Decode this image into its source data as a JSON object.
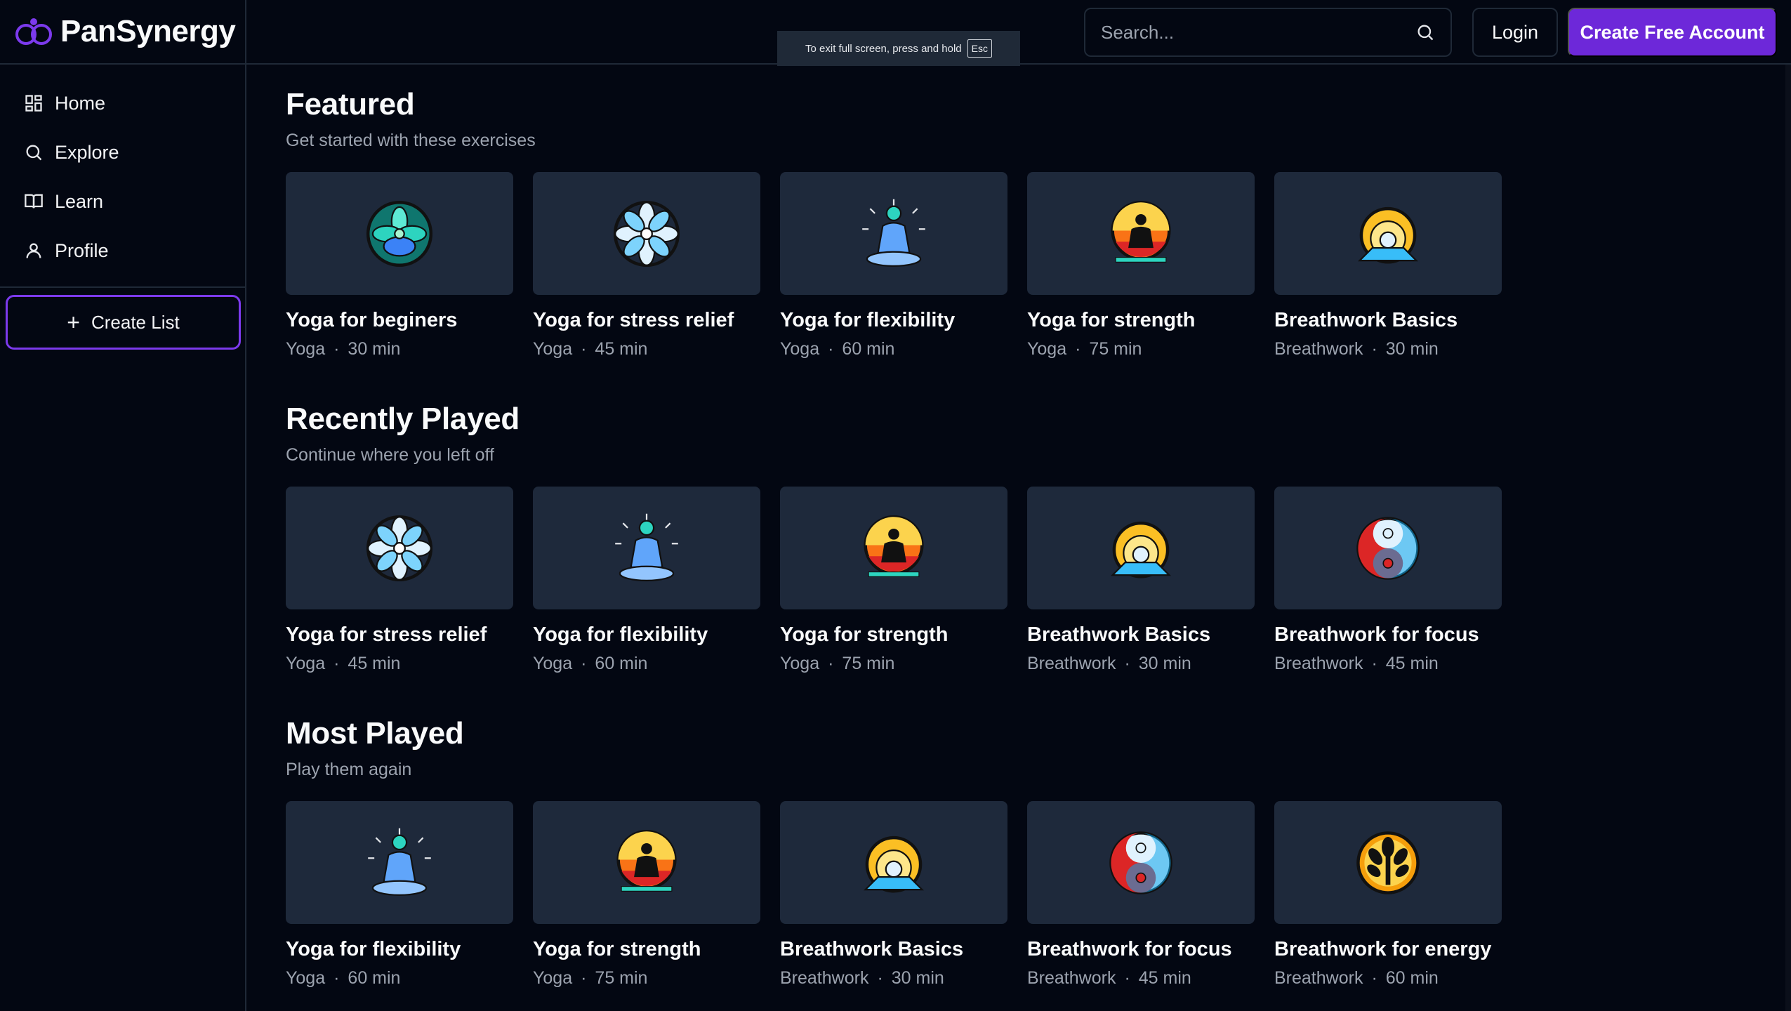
{
  "brand": {
    "name": "PanSynergy",
    "accent": "#6d28d9"
  },
  "sidebar": {
    "items": [
      {
        "label": "Home",
        "icon": "grid-icon"
      },
      {
        "label": "Explore",
        "icon": "search-icon"
      },
      {
        "label": "Learn",
        "icon": "book-icon"
      },
      {
        "label": "Profile",
        "icon": "user-icon"
      }
    ],
    "create_list_label": "Create List"
  },
  "topbar": {
    "fullscreen_notice": "To exit full screen, press and hold",
    "fullscreen_key": "Esc",
    "search_placeholder": "Search...",
    "login_label": "Login",
    "signup_label": "Create Free Account"
  },
  "sections": [
    {
      "title": "Featured",
      "subtitle": "Get started with these exercises",
      "cards": [
        {
          "title": "Yoga for beginers",
          "category": "Yoga",
          "duration": "30 min",
          "icon": "lotus-green"
        },
        {
          "title": "Yoga for stress relief",
          "category": "Yoga",
          "duration": "45 min",
          "icon": "flower-white"
        },
        {
          "title": "Yoga for flexibility",
          "category": "Yoga",
          "duration": "60 min",
          "icon": "meditation-blue"
        },
        {
          "title": "Yoga for strength",
          "category": "Yoga",
          "duration": "75 min",
          "icon": "meditation-sunset"
        },
        {
          "title": "Breathwork Basics",
          "category": "Breathwork",
          "duration": "30 min",
          "icon": "sunrise"
        }
      ]
    },
    {
      "title": "Recently Played",
      "subtitle": "Continue where you left off",
      "cards": [
        {
          "title": "Yoga for stress relief",
          "category": "Yoga",
          "duration": "45 min",
          "icon": "flower-white"
        },
        {
          "title": "Yoga for flexibility",
          "category": "Yoga",
          "duration": "60 min",
          "icon": "meditation-blue"
        },
        {
          "title": "Yoga for strength",
          "category": "Yoga",
          "duration": "75 min",
          "icon": "meditation-sunset"
        },
        {
          "title": "Breathwork Basics",
          "category": "Breathwork",
          "duration": "30 min",
          "icon": "sunrise"
        },
        {
          "title": "Breathwork for focus",
          "category": "Breathwork",
          "duration": "45 min",
          "icon": "yin-yang"
        }
      ]
    },
    {
      "title": "Most Played",
      "subtitle": "Play them again",
      "cards": [
        {
          "title": "Yoga for flexibility",
          "category": "Yoga",
          "duration": "60 min",
          "icon": "meditation-blue"
        },
        {
          "title": "Yoga for strength",
          "category": "Yoga",
          "duration": "75 min",
          "icon": "meditation-sunset"
        },
        {
          "title": "Breathwork Basics",
          "category": "Breathwork",
          "duration": "30 min",
          "icon": "sunrise"
        },
        {
          "title": "Breathwork for focus",
          "category": "Breathwork",
          "duration": "45 min",
          "icon": "yin-yang"
        },
        {
          "title": "Breathwork for energy",
          "category": "Breathwork",
          "duration": "60 min",
          "icon": "tree-orange"
        }
      ]
    }
  ]
}
